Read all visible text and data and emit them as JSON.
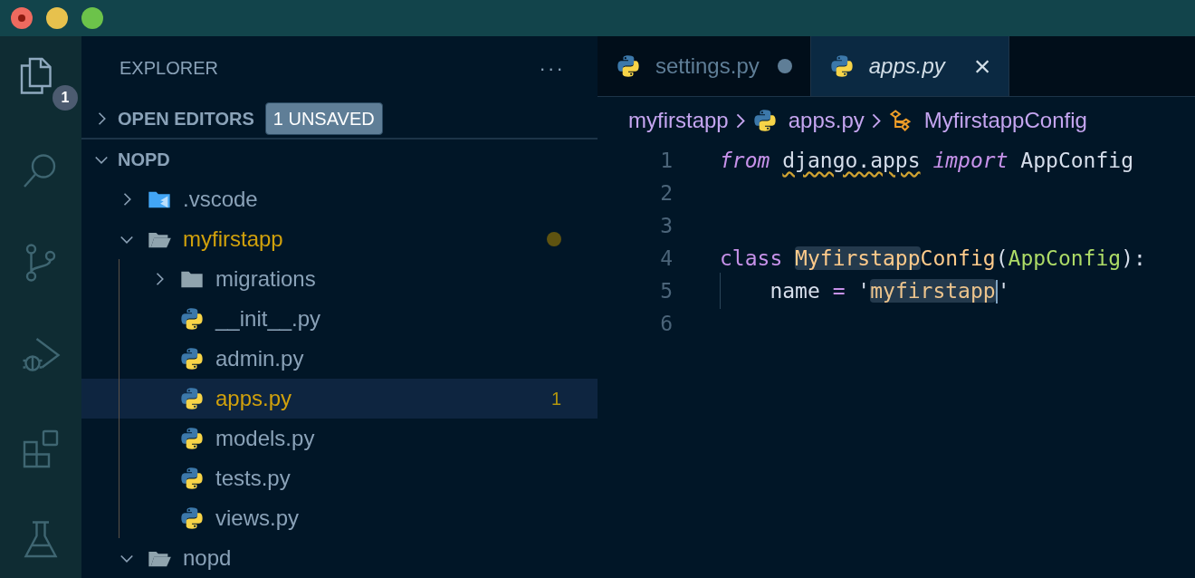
{
  "activity_bar": [
    {
      "kind": "files",
      "selected": true,
      "badge": "1"
    },
    {
      "kind": "search",
      "selected": false
    },
    {
      "kind": "source-control",
      "selected": false
    },
    {
      "kind": "run-debug",
      "selected": false
    },
    {
      "kind": "extensions",
      "selected": false
    },
    {
      "kind": "flask",
      "selected": false
    }
  ],
  "sidebar": {
    "title": "EXPLORER",
    "more": "···",
    "open_editors": {
      "label": "OPEN EDITORS",
      "expanded": false,
      "badge": "1 UNSAVED"
    },
    "root": {
      "label": "NOPD",
      "expanded": true,
      "children": [
        {
          "name": ".vscode",
          "kind": "vscode-folder",
          "expanded": false,
          "modified": false,
          "selected": false
        },
        {
          "name": "myfirstapp",
          "kind": "folder",
          "expanded": true,
          "modified": true,
          "selected": false,
          "children": [
            {
              "name": "migrations",
              "kind": "folder",
              "expanded": false,
              "modified": false,
              "selected": false
            },
            {
              "name": "__init__.py",
              "kind": "python",
              "modified": false,
              "selected": false
            },
            {
              "name": "admin.py",
              "kind": "python",
              "modified": false,
              "selected": false
            },
            {
              "name": "apps.py",
              "kind": "python",
              "modified": true,
              "selected": true,
              "badge": "1"
            },
            {
              "name": "models.py",
              "kind": "python",
              "modified": false,
              "selected": false
            },
            {
              "name": "tests.py",
              "kind": "python",
              "modified": false,
              "selected": false
            },
            {
              "name": "views.py",
              "kind": "python",
              "modified": false,
              "selected": false
            }
          ]
        },
        {
          "name": "nopd",
          "kind": "folder",
          "expanded": true,
          "modified": false,
          "selected": false
        }
      ]
    }
  },
  "tabs": [
    {
      "label": "settings.py",
      "selected": false,
      "dirty": true
    },
    {
      "label": "apps.py",
      "selected": true,
      "dirty": false,
      "close": "×"
    }
  ],
  "breadcrumb": [
    {
      "label": "myfirstapp",
      "kind": "folder"
    },
    {
      "label": "apps.py",
      "kind": "python"
    },
    {
      "label": "MyfirstappConfig",
      "kind": "class"
    }
  ],
  "code": [
    {
      "number": "1",
      "tokens": [
        {
          "text": "from ",
          "kind": "keyword-italic"
        },
        {
          "text": "django.apps",
          "kind": "warning"
        },
        {
          "text": " import",
          "kind": "keyword-italic"
        },
        {
          "text": " AppConfig",
          "kind": "plain"
        }
      ]
    },
    {
      "number": "2"
    },
    {
      "number": "3"
    },
    {
      "number": "4",
      "tokens": [
        {
          "text": "class ",
          "kind": "keyword"
        },
        {
          "text": "Myfirstapp",
          "kind": "class",
          "highlight": true
        },
        {
          "text": "Config",
          "kind": "class"
        },
        {
          "text": "(",
          "kind": "plain"
        },
        {
          "text": "AppConfig",
          "kind": "base"
        },
        {
          "text": "):",
          "kind": "plain"
        }
      ]
    },
    {
      "number": "5",
      "indent": true,
      "tokens": [
        {
          "text": "    name ",
          "kind": "plain"
        },
        {
          "text": "=",
          "kind": "operator"
        },
        {
          "text": " '",
          "kind": "plain"
        },
        {
          "text": "myfirstapp",
          "kind": "string",
          "highlight": true,
          "cursor": true
        },
        {
          "text": "'",
          "kind": "plain"
        }
      ]
    },
    {
      "number": "6"
    }
  ]
}
